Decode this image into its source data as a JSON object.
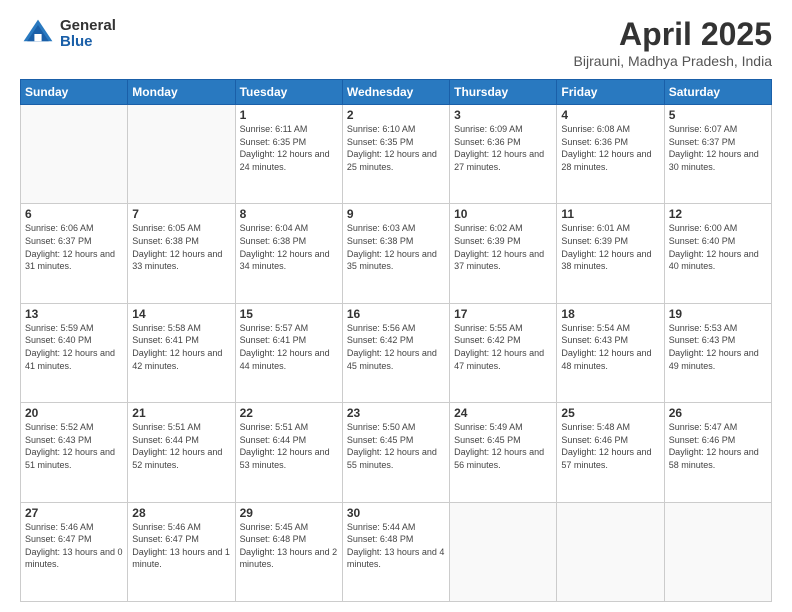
{
  "logo": {
    "general": "General",
    "blue": "Blue"
  },
  "title": {
    "month": "April 2025",
    "location": "Bijrauni, Madhya Pradesh, India"
  },
  "weekdays": [
    "Sunday",
    "Monday",
    "Tuesday",
    "Wednesday",
    "Thursday",
    "Friday",
    "Saturday"
  ],
  "weeks": [
    [
      {
        "day": "",
        "sunrise": "",
        "sunset": "",
        "daylight": ""
      },
      {
        "day": "",
        "sunrise": "",
        "sunset": "",
        "daylight": ""
      },
      {
        "day": "1",
        "sunrise": "Sunrise: 6:11 AM",
        "sunset": "Sunset: 6:35 PM",
        "daylight": "Daylight: 12 hours and 24 minutes."
      },
      {
        "day": "2",
        "sunrise": "Sunrise: 6:10 AM",
        "sunset": "Sunset: 6:35 PM",
        "daylight": "Daylight: 12 hours and 25 minutes."
      },
      {
        "day": "3",
        "sunrise": "Sunrise: 6:09 AM",
        "sunset": "Sunset: 6:36 PM",
        "daylight": "Daylight: 12 hours and 27 minutes."
      },
      {
        "day": "4",
        "sunrise": "Sunrise: 6:08 AM",
        "sunset": "Sunset: 6:36 PM",
        "daylight": "Daylight: 12 hours and 28 minutes."
      },
      {
        "day": "5",
        "sunrise": "Sunrise: 6:07 AM",
        "sunset": "Sunset: 6:37 PM",
        "daylight": "Daylight: 12 hours and 30 minutes."
      }
    ],
    [
      {
        "day": "6",
        "sunrise": "Sunrise: 6:06 AM",
        "sunset": "Sunset: 6:37 PM",
        "daylight": "Daylight: 12 hours and 31 minutes."
      },
      {
        "day": "7",
        "sunrise": "Sunrise: 6:05 AM",
        "sunset": "Sunset: 6:38 PM",
        "daylight": "Daylight: 12 hours and 33 minutes."
      },
      {
        "day": "8",
        "sunrise": "Sunrise: 6:04 AM",
        "sunset": "Sunset: 6:38 PM",
        "daylight": "Daylight: 12 hours and 34 minutes."
      },
      {
        "day": "9",
        "sunrise": "Sunrise: 6:03 AM",
        "sunset": "Sunset: 6:38 PM",
        "daylight": "Daylight: 12 hours and 35 minutes."
      },
      {
        "day": "10",
        "sunrise": "Sunrise: 6:02 AM",
        "sunset": "Sunset: 6:39 PM",
        "daylight": "Daylight: 12 hours and 37 minutes."
      },
      {
        "day": "11",
        "sunrise": "Sunrise: 6:01 AM",
        "sunset": "Sunset: 6:39 PM",
        "daylight": "Daylight: 12 hours and 38 minutes."
      },
      {
        "day": "12",
        "sunrise": "Sunrise: 6:00 AM",
        "sunset": "Sunset: 6:40 PM",
        "daylight": "Daylight: 12 hours and 40 minutes."
      }
    ],
    [
      {
        "day": "13",
        "sunrise": "Sunrise: 5:59 AM",
        "sunset": "Sunset: 6:40 PM",
        "daylight": "Daylight: 12 hours and 41 minutes."
      },
      {
        "day": "14",
        "sunrise": "Sunrise: 5:58 AM",
        "sunset": "Sunset: 6:41 PM",
        "daylight": "Daylight: 12 hours and 42 minutes."
      },
      {
        "day": "15",
        "sunrise": "Sunrise: 5:57 AM",
        "sunset": "Sunset: 6:41 PM",
        "daylight": "Daylight: 12 hours and 44 minutes."
      },
      {
        "day": "16",
        "sunrise": "Sunrise: 5:56 AM",
        "sunset": "Sunset: 6:42 PM",
        "daylight": "Daylight: 12 hours and 45 minutes."
      },
      {
        "day": "17",
        "sunrise": "Sunrise: 5:55 AM",
        "sunset": "Sunset: 6:42 PM",
        "daylight": "Daylight: 12 hours and 47 minutes."
      },
      {
        "day": "18",
        "sunrise": "Sunrise: 5:54 AM",
        "sunset": "Sunset: 6:43 PM",
        "daylight": "Daylight: 12 hours and 48 minutes."
      },
      {
        "day": "19",
        "sunrise": "Sunrise: 5:53 AM",
        "sunset": "Sunset: 6:43 PM",
        "daylight": "Daylight: 12 hours and 49 minutes."
      }
    ],
    [
      {
        "day": "20",
        "sunrise": "Sunrise: 5:52 AM",
        "sunset": "Sunset: 6:43 PM",
        "daylight": "Daylight: 12 hours and 51 minutes."
      },
      {
        "day": "21",
        "sunrise": "Sunrise: 5:51 AM",
        "sunset": "Sunset: 6:44 PM",
        "daylight": "Daylight: 12 hours and 52 minutes."
      },
      {
        "day": "22",
        "sunrise": "Sunrise: 5:51 AM",
        "sunset": "Sunset: 6:44 PM",
        "daylight": "Daylight: 12 hours and 53 minutes."
      },
      {
        "day": "23",
        "sunrise": "Sunrise: 5:50 AM",
        "sunset": "Sunset: 6:45 PM",
        "daylight": "Daylight: 12 hours and 55 minutes."
      },
      {
        "day": "24",
        "sunrise": "Sunrise: 5:49 AM",
        "sunset": "Sunset: 6:45 PM",
        "daylight": "Daylight: 12 hours and 56 minutes."
      },
      {
        "day": "25",
        "sunrise": "Sunrise: 5:48 AM",
        "sunset": "Sunset: 6:46 PM",
        "daylight": "Daylight: 12 hours and 57 minutes."
      },
      {
        "day": "26",
        "sunrise": "Sunrise: 5:47 AM",
        "sunset": "Sunset: 6:46 PM",
        "daylight": "Daylight: 12 hours and 58 minutes."
      }
    ],
    [
      {
        "day": "27",
        "sunrise": "Sunrise: 5:46 AM",
        "sunset": "Sunset: 6:47 PM",
        "daylight": "Daylight: 13 hours and 0 minutes."
      },
      {
        "day": "28",
        "sunrise": "Sunrise: 5:46 AM",
        "sunset": "Sunset: 6:47 PM",
        "daylight": "Daylight: 13 hours and 1 minute."
      },
      {
        "day": "29",
        "sunrise": "Sunrise: 5:45 AM",
        "sunset": "Sunset: 6:48 PM",
        "daylight": "Daylight: 13 hours and 2 minutes."
      },
      {
        "day": "30",
        "sunrise": "Sunrise: 5:44 AM",
        "sunset": "Sunset: 6:48 PM",
        "daylight": "Daylight: 13 hours and 4 minutes."
      },
      {
        "day": "",
        "sunrise": "",
        "sunset": "",
        "daylight": ""
      },
      {
        "day": "",
        "sunrise": "",
        "sunset": "",
        "daylight": ""
      },
      {
        "day": "",
        "sunrise": "",
        "sunset": "",
        "daylight": ""
      }
    ]
  ]
}
